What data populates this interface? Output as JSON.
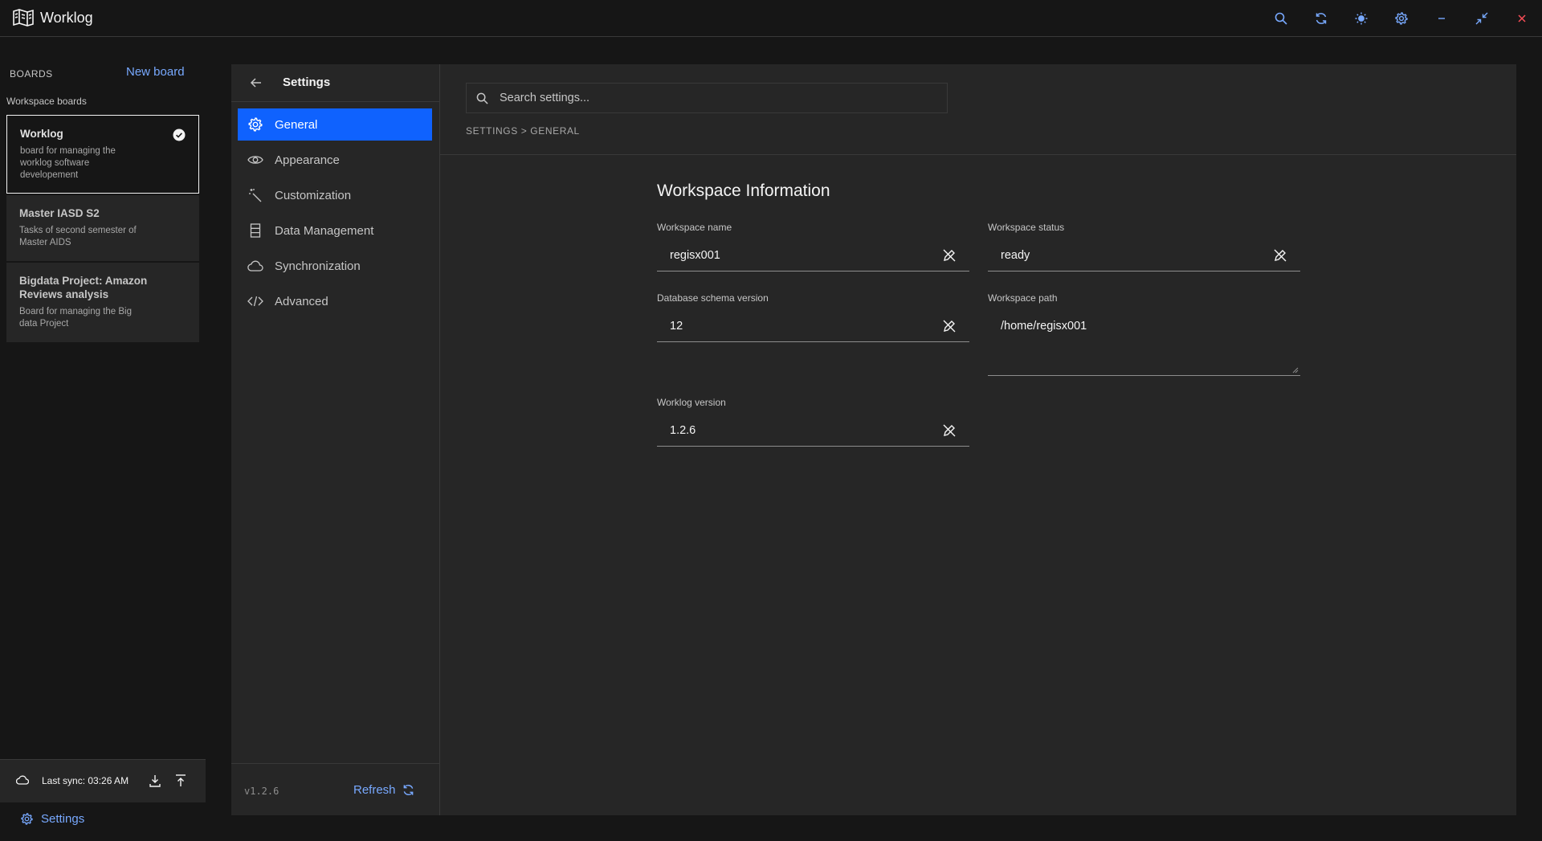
{
  "app": {
    "title": "Worklog",
    "icons": [
      "map-logo-icon",
      "search-icon",
      "sync-icon",
      "brightness-icon",
      "gear-icon",
      "minimize-icon",
      "restore-icon",
      "close-icon"
    ]
  },
  "sidebar": {
    "boards_label": "BOARDS",
    "new_board": "New board",
    "workspace_boards": "Workspace boards",
    "boards": [
      {
        "title": "Worklog",
        "description": "board for managing the worklog software developement",
        "active": true
      },
      {
        "title": "Master IASD S2",
        "description": "Tasks of second semester of Master AIDS",
        "active": false
      },
      {
        "title": "Bigdata Project: Amazon Reviews analysis",
        "description": "Board for managing the Big data Project",
        "active": false
      }
    ],
    "last_sync": "Last sync: 03:26 AM",
    "settings_link": "Settings"
  },
  "settings": {
    "title": "Settings",
    "nav": [
      {
        "label": "General",
        "icon": "gear-icon",
        "active": true
      },
      {
        "label": "Appearance",
        "icon": "eye-icon",
        "active": false
      },
      {
        "label": "Customization",
        "icon": "magic-wand-icon",
        "active": false
      },
      {
        "label": "Data Management",
        "icon": "database-icon",
        "active": false
      },
      {
        "label": "Synchronization",
        "icon": "cloud-icon",
        "active": false
      },
      {
        "label": "Advanced",
        "icon": "code-icon",
        "active": false
      }
    ],
    "version": "v1.2.6",
    "refresh": "Refresh",
    "search_placeholder": "Search settings...",
    "breadcrumb": "SETTINGS > GENERAL",
    "section_title": "Workspace Information",
    "fields": {
      "workspace_name": {
        "label": "Workspace name",
        "value": "regisx001"
      },
      "workspace_status": {
        "label": "Workspace status",
        "value": "ready"
      },
      "db_schema_version": {
        "label": "Database schema version",
        "value": "12"
      },
      "workspace_path": {
        "label": "Workspace path",
        "value": "/home/regisx001"
      },
      "worklog_version": {
        "label": "Worklog version",
        "value": "1.2.6"
      }
    }
  },
  "colors": {
    "background": "#161616",
    "panel": "#262626",
    "accent": "#0f62fe",
    "link": "#78a9ff",
    "close": "#fa4d56"
  }
}
